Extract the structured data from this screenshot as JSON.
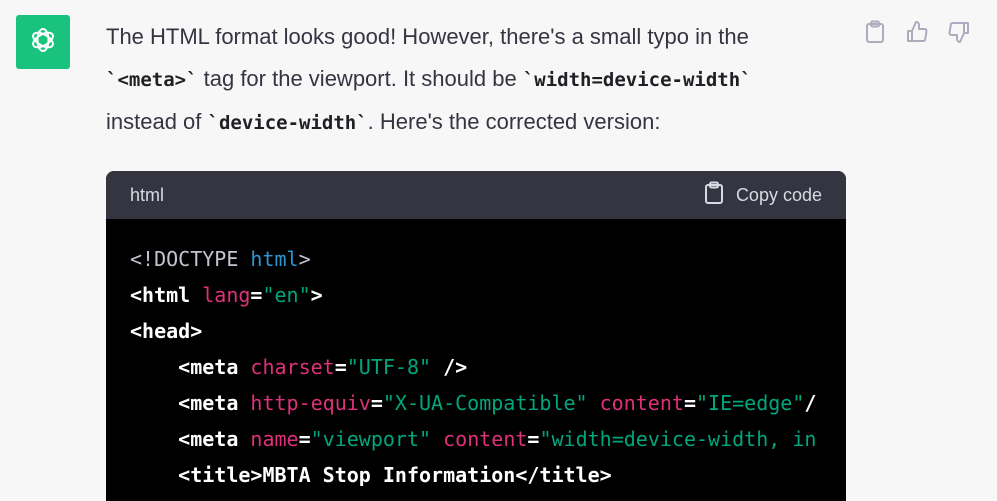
{
  "avatar": {
    "icon": "openai-logo-icon",
    "color": "#19c37d"
  },
  "message": {
    "t1": "The HTML format looks good! However, there's a small typo in the",
    "c1": "`<meta>`",
    "t2": " tag for the viewport. It should be ",
    "c2": "`width=device-width`",
    "t3": "instead of ",
    "c3": "`device-width`",
    "t4": ". Here's the corrected version:"
  },
  "actions": [
    "clipboard-icon",
    "thumbs-up-icon",
    "thumbs-down-icon"
  ],
  "code_block": {
    "language": "html",
    "copy_label": "Copy code",
    "lines": [
      [
        {
          "t": "<!DOCTYPE ",
          "c": "gray"
        },
        {
          "t": "html",
          "c": "blue"
        },
        {
          "t": ">",
          "c": "gray"
        }
      ],
      [
        {
          "t": "<html ",
          "c": "tag"
        },
        {
          "t": "lang",
          "c": "attr"
        },
        {
          "t": "=",
          "c": "plain"
        },
        {
          "t": "\"en\"",
          "c": "str"
        },
        {
          "t": ">",
          "c": "tag"
        }
      ],
      [
        {
          "t": "<head>",
          "c": "tag"
        }
      ],
      [
        {
          "t": "    <meta ",
          "c": "tag"
        },
        {
          "t": "charset",
          "c": "attr"
        },
        {
          "t": "=",
          "c": "plain"
        },
        {
          "t": "\"UTF-8\"",
          "c": "str"
        },
        {
          "t": " />",
          "c": "tag"
        }
      ],
      [
        {
          "t": "    <meta ",
          "c": "tag"
        },
        {
          "t": "http-equiv",
          "c": "attr"
        },
        {
          "t": "=",
          "c": "plain"
        },
        {
          "t": "\"X-UA-Compatible\"",
          "c": "str"
        },
        {
          "t": " ",
          "c": "plain"
        },
        {
          "t": "content",
          "c": "attr"
        },
        {
          "t": "=",
          "c": "plain"
        },
        {
          "t": "\"IE=edge\"",
          "c": "str"
        },
        {
          "t": "/",
          "c": "tag"
        }
      ],
      [
        {
          "t": "    <meta ",
          "c": "tag"
        },
        {
          "t": "name",
          "c": "attr"
        },
        {
          "t": "=",
          "c": "plain"
        },
        {
          "t": "\"viewport\"",
          "c": "str"
        },
        {
          "t": " ",
          "c": "plain"
        },
        {
          "t": "content",
          "c": "attr"
        },
        {
          "t": "=",
          "c": "plain"
        },
        {
          "t": "\"width=device-width, in",
          "c": "str"
        }
      ],
      [
        {
          "t": "    <title>",
          "c": "tag"
        },
        {
          "t": "MBTA Stop Information",
          "c": "plain"
        },
        {
          "t": "</title>",
          "c": "tag"
        }
      ]
    ]
  }
}
